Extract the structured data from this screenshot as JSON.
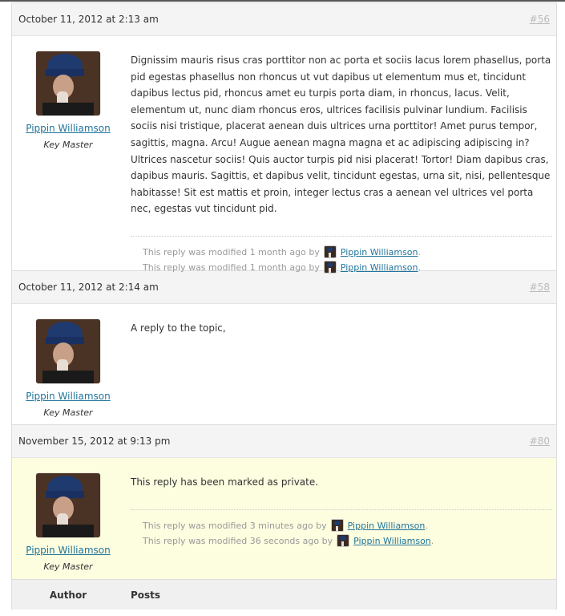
{
  "replies": [
    {
      "date": "October 11, 2012 at 2:13 am",
      "permalink": "#56",
      "author": "Pippin Williamson",
      "role": "Key Master",
      "content": "Dignissim mauris risus cras porttitor non ac porta et sociis lacus lorem phasellus, porta pid egestas phasellus non rhoncus ut vut dapibus ut elementum mus et, tincidunt dapibus lectus pid, rhoncus amet eu turpis porta diam, in rhoncus, lacus. Velit, elementum ut, nunc diam rhoncus eros, ultrices facilisis pulvinar lundium. Facilisis sociis nisi tristique, placerat aenean duis ultrices urna porttitor! Amet purus tempor, sagittis, magna. Arcu! Augue aenean magna magna et ac adipiscing adipiscing in? Ultrices nascetur sociis! Quis auctor turpis pid nisi placerat! Tortor! Diam dapibus cras, dapibus mauris. Sagittis, et dapibus velit, tincidunt egestas, urna sit, nisi, pellentesque habitasse! Sit est mattis et proin, integer lectus cras a aenean vel ultrices vel porta nec, egestas vut tincidunt pid.",
      "revisions": [
        {
          "text": "This reply was modified 1 month ago by",
          "author": "Pippin Williamson"
        },
        {
          "text": "This reply was modified 1 month ago by",
          "author": "Pippin Williamson"
        }
      ]
    },
    {
      "date": "October 11, 2012 at 2:14 am",
      "permalink": "#58",
      "author": "Pippin Williamson",
      "role": "Key Master",
      "content": "A reply to the topic,"
    },
    {
      "date": "November 15, 2012 at 9:13 pm",
      "permalink": "#80",
      "author": "Pippin Williamson",
      "role": "Key Master",
      "content": "This reply has been marked as private.",
      "revisions": [
        {
          "text": "This reply was modified 3 minutes ago by",
          "author": "Pippin Williamson"
        },
        {
          "text": "This reply was modified 36 seconds ago by",
          "author": "Pippin Williamson"
        }
      ]
    }
  ],
  "footer": {
    "author_label": "Author",
    "posts_label": "Posts"
  }
}
